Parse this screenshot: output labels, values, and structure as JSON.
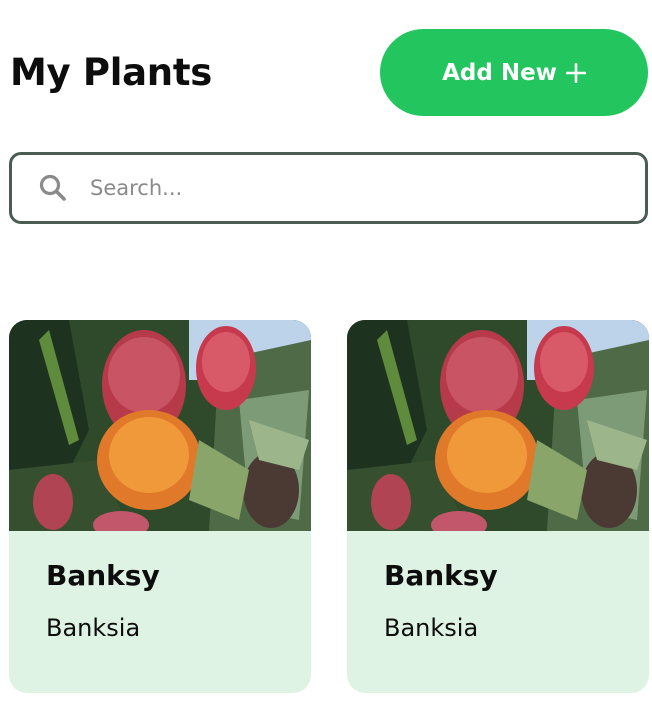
{
  "header": {
    "title": "My Plants",
    "add_button_label": "Add New"
  },
  "search": {
    "placeholder": "Search..."
  },
  "plants": [
    {
      "name": "Banksy",
      "species": "Banksia"
    },
    {
      "name": "Banksy",
      "species": "Banksia"
    }
  ],
  "icons": {
    "add": "plus-icon",
    "search": "search-icon"
  },
  "colors": {
    "accent": "#22c55e",
    "card_background": "#dff3e4",
    "search_border": "#4b5c55"
  }
}
